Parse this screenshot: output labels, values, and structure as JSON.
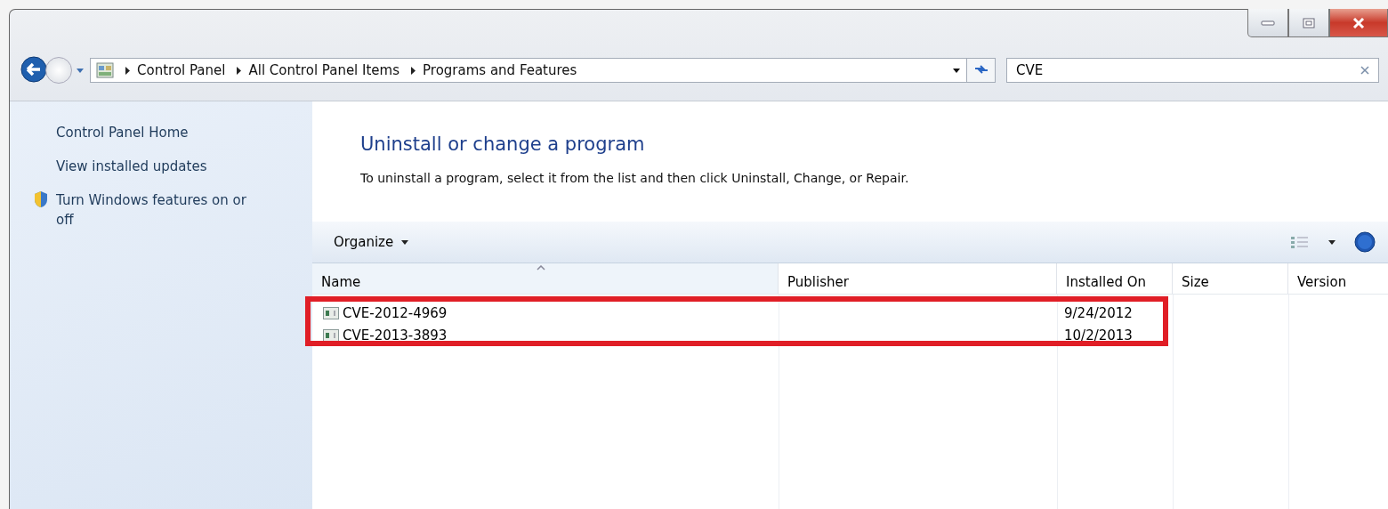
{
  "address_bar": {
    "breadcrumbs": [
      "Control Panel",
      "All Control Panel Items",
      "Programs and Features"
    ]
  },
  "search": {
    "value": "CVE"
  },
  "sidebar": {
    "items": [
      {
        "label": "Control Panel Home",
        "kind": "link"
      },
      {
        "label": "View installed updates",
        "kind": "link"
      },
      {
        "label": "Turn Windows features on or off",
        "kind": "shield"
      }
    ]
  },
  "main": {
    "title": "Uninstall or change a program",
    "description": "To uninstall a program, select it from the list and then click Uninstall, Change, or Repair."
  },
  "toolbar": {
    "organize": "Organize"
  },
  "table": {
    "columns": [
      "Name",
      "Publisher",
      "Installed On",
      "Size",
      "Version"
    ],
    "rows": [
      {
        "name": "CVE-2012-4969",
        "publisher": "",
        "installed_on": "9/24/2012",
        "highlighted": true
      },
      {
        "name": "CVE-2013-3893",
        "publisher": "",
        "installed_on": "10/2/2013",
        "highlighted": true
      }
    ]
  }
}
